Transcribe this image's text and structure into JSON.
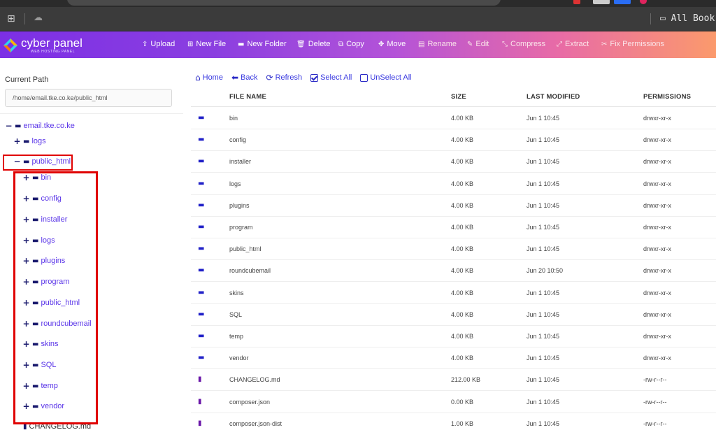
{
  "bookmarks": {
    "all_label": "All Book"
  },
  "brand": {
    "name": "cyber panel",
    "tagline": "WEB HOSTING PANEL"
  },
  "toolbar": [
    {
      "icon": "upload-icon",
      "label": "Upload"
    },
    {
      "icon": "new-file-icon",
      "label": "New File"
    },
    {
      "icon": "new-folder-icon",
      "label": "New Folder"
    },
    {
      "icon": "trash-icon",
      "label": "Delete"
    },
    {
      "icon": "copy-icon",
      "label": "Copy"
    },
    {
      "icon": "move-icon",
      "label": "Move"
    },
    {
      "icon": "rename-icon",
      "label": "Rename"
    },
    {
      "icon": "edit-icon",
      "label": "Edit"
    },
    {
      "icon": "compress-icon",
      "label": "Compress"
    },
    {
      "icon": "extract-icon",
      "label": "Extract"
    },
    {
      "icon": "wrench-icon",
      "label": "Fix Permissions"
    }
  ],
  "sidebar": {
    "current_path_label": "Current Path",
    "current_path_value": "/home/email.tke.co.ke/public_html",
    "tree": {
      "root": "email.tke.co.ke",
      "logs": "logs",
      "public_html": "public_html",
      "children": [
        "bin",
        "config",
        "installer",
        "logs",
        "plugins",
        "program",
        "public_html",
        "roundcubemail",
        "skins",
        "SQL",
        "temp",
        "vendor"
      ],
      "file": "CHANGELOG.md"
    }
  },
  "nav": {
    "home": "Home",
    "back": "Back",
    "refresh": "Refresh",
    "select_all": "Select All",
    "unselect_all": "UnSelect All"
  },
  "table": {
    "headers": {
      "name": "FILE NAME",
      "size": "SIZE",
      "modified": "LAST MODIFIED",
      "permissions": "PERMISSIONS"
    },
    "rows": [
      {
        "type": "folder",
        "name": "bin",
        "size": "4.00 KB",
        "modified": "Jun 1 10:45",
        "perms": "drwxr-xr-x"
      },
      {
        "type": "folder",
        "name": "config",
        "size": "4.00 KB",
        "modified": "Jun 1 10:45",
        "perms": "drwxr-xr-x"
      },
      {
        "type": "folder",
        "name": "installer",
        "size": "4.00 KB",
        "modified": "Jun 1 10:45",
        "perms": "drwxr-xr-x"
      },
      {
        "type": "folder",
        "name": "logs",
        "size": "4.00 KB",
        "modified": "Jun 1 10:45",
        "perms": "drwxr-xr-x"
      },
      {
        "type": "folder",
        "name": "plugins",
        "size": "4.00 KB",
        "modified": "Jun 1 10:45",
        "perms": "drwxr-xr-x"
      },
      {
        "type": "folder",
        "name": "program",
        "size": "4.00 KB",
        "modified": "Jun 1 10:45",
        "perms": "drwxr-xr-x"
      },
      {
        "type": "folder",
        "name": "public_html",
        "size": "4.00 KB",
        "modified": "Jun 1 10:45",
        "perms": "drwxr-xr-x"
      },
      {
        "type": "folder",
        "name": "roundcubemail",
        "size": "4.00 KB",
        "modified": "Jun 20 10:50",
        "perms": "drwxr-xr-x"
      },
      {
        "type": "folder",
        "name": "skins",
        "size": "4.00 KB",
        "modified": "Jun 1 10:45",
        "perms": "drwxr-xr-x"
      },
      {
        "type": "folder",
        "name": "SQL",
        "size": "4.00 KB",
        "modified": "Jun 1 10:45",
        "perms": "drwxr-xr-x"
      },
      {
        "type": "folder",
        "name": "temp",
        "size": "4.00 KB",
        "modified": "Jun 1 10:45",
        "perms": "drwxr-xr-x"
      },
      {
        "type": "folder",
        "name": "vendor",
        "size": "4.00 KB",
        "modified": "Jun 1 10:45",
        "perms": "drwxr-xr-x"
      },
      {
        "type": "file",
        "name": "CHANGELOG.md",
        "size": "212.00 KB",
        "modified": "Jun 1 10:45",
        "perms": "-rw-r--r--"
      },
      {
        "type": "file",
        "name": "composer.json",
        "size": "0.00 KB",
        "modified": "Jun 1 10:45",
        "perms": "-rw-r--r--"
      },
      {
        "type": "file",
        "name": "composer.json-dist",
        "size": "1.00 KB",
        "modified": "Jun 1 10:45",
        "perms": "-rw-r--r--"
      }
    ]
  },
  "colors": {
    "header_start": "#7c2fe5",
    "header_end": "#fb9a6c",
    "link": "#3b3be0",
    "folder_icon": "#2121c8",
    "file_icon": "#6a17a8",
    "highlight": "#e00000"
  }
}
